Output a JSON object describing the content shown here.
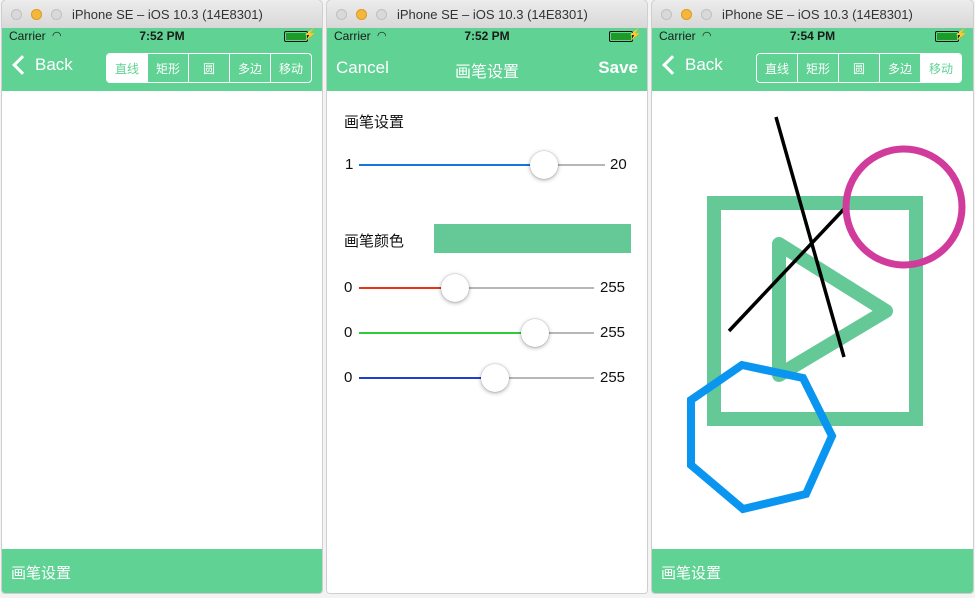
{
  "windows": [
    {
      "title": "iPhone SE – iOS 10.3 (14E8301)",
      "status": {
        "carrier": "Carrier",
        "time": "7:52 PM"
      },
      "nav": {
        "back": "Back",
        "segments": [
          "直线",
          "矩形",
          "圆",
          "多边",
          "移动"
        ],
        "selected": 0
      },
      "bottom_label": "画笔设置"
    },
    {
      "title": "iPhone SE – iOS 10.3 (14E8301)",
      "status": {
        "carrier": "Carrier",
        "time": "7:52 PM"
      },
      "nav": {
        "cancel": "Cancel",
        "title": "画笔设置",
        "save": "Save"
      },
      "brush_heading": "画笔设置",
      "width_slider": {
        "min": "1",
        "max": "20",
        "value": 0.75,
        "color": "#1a73d9"
      },
      "color_heading": "画笔颜色",
      "color_swatch": "#64c996",
      "red_slider": {
        "min": "0",
        "max": "255",
        "value": 0.41,
        "color": "#e8321a"
      },
      "green_slider": {
        "min": "0",
        "max": "255",
        "value": 0.75,
        "color": "#2ecc3a"
      },
      "blue_slider": {
        "min": "0",
        "max": "255",
        "value": 0.58,
        "color": "#1f3fcf"
      }
    },
    {
      "title": "iPhone SE – iOS 10.3 (14E8301)",
      "status": {
        "carrier": "Carrier",
        "time": "7:54 PM"
      },
      "nav": {
        "back": "Back",
        "segments": [
          "直线",
          "矩形",
          "圆",
          "多边",
          "移动"
        ],
        "selected": 4
      },
      "bottom_label": "画笔设置"
    }
  ],
  "canvas_colors": {
    "rect": "#64c996",
    "triangle": "#64c996",
    "line": "#000000",
    "circle": "#d03b9c",
    "polygon": "#0a96f0"
  }
}
